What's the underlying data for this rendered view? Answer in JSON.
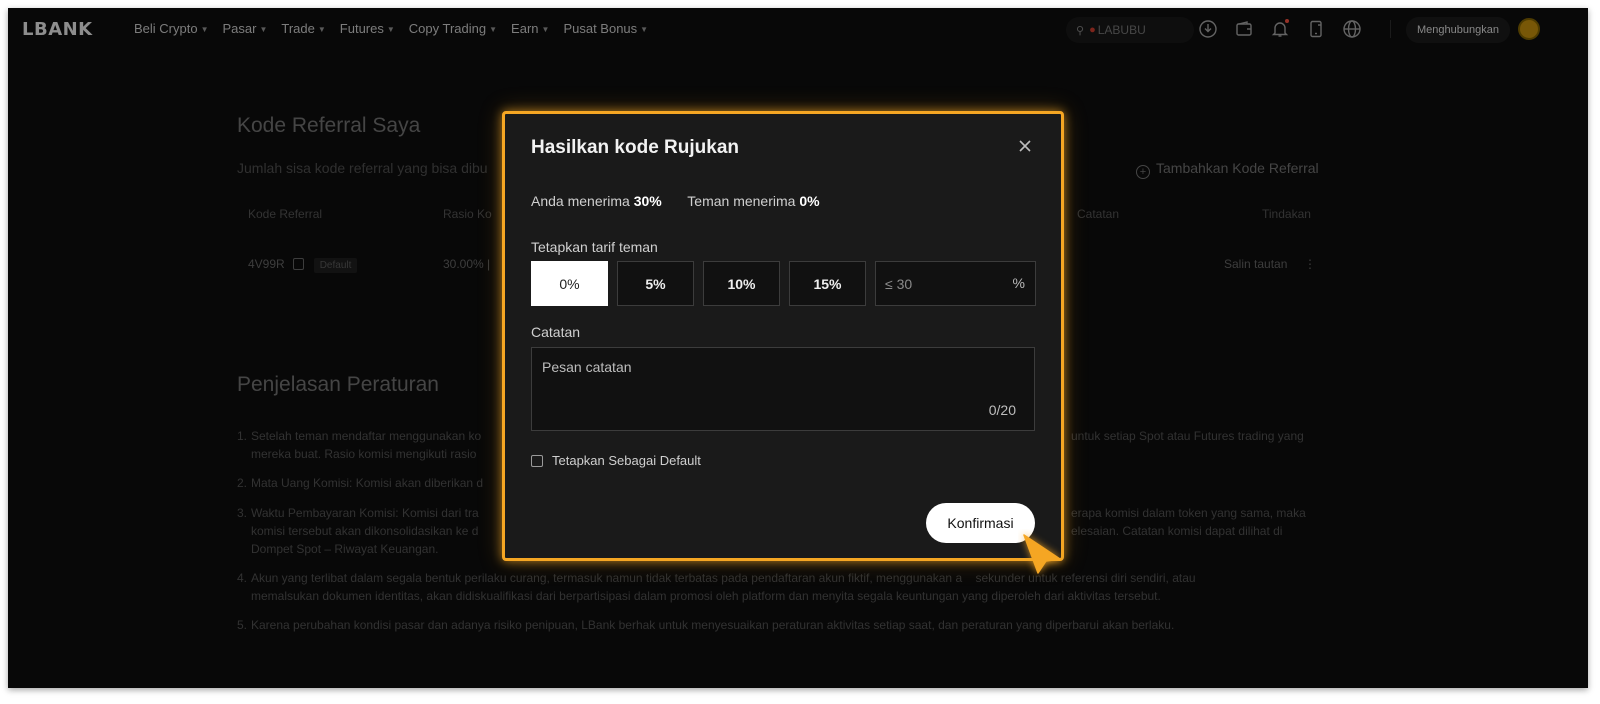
{
  "brand": {
    "logo": "LBANK",
    "accent_color": "#f5a623"
  },
  "nav": {
    "items": [
      "Beli Crypto",
      "Pasar",
      "Trade",
      "Futures",
      "Copy Trading",
      "Earn",
      "Pusat Bonus"
    ],
    "search_placeholder": "LABUBU",
    "connect_label": "Menghubungkan",
    "icons": [
      "download-icon",
      "wallet-icon",
      "bell-icon",
      "app-icon",
      "globe-icon"
    ]
  },
  "page": {
    "title": "Kode Referral Saya",
    "subtitle": "Jumlah sisa kode referral yang bisa dibu",
    "add_referral": "Tambahkan Kode Referral",
    "table": {
      "headers": [
        "Kode Referral",
        "Rasio Ko",
        "Catatan",
        "Tindakan"
      ],
      "row": {
        "code": "4V99R",
        "tag": "Default",
        "ratio": "30.00% |",
        "action": "Salin tautan"
      }
    },
    "rules_title": "Penjelasan Peraturan",
    "rules": [
      {
        "num": "1.",
        "text": "Setelah teman mendaftar menggunakan ko"
      },
      {
        "num": "",
        "text": "mereka buat. Rasio komisi mengikuti rasio"
      },
      {
        "num": "",
        "text": "untuk setiap Spot atau Futures trading yang"
      },
      {
        "num": "2.",
        "text": "Mata Uang Komisi: Komisi akan diberikan d"
      },
      {
        "num": "3.",
        "text": "Waktu Pembayaran Komisi: Komisi dari tra"
      },
      {
        "num": "",
        "text": "komisi tersebut akan dikonsolidasikan ke d"
      },
      {
        "num": "",
        "text": "Dompet Spot – Riwayat Keuangan."
      },
      {
        "num": "",
        "text": "erapa komisi dalam token yang sama, maka"
      },
      {
        "num": "",
        "text": "elesaian. Catatan komisi dapat dilihat di"
      },
      {
        "num": "4.",
        "text": "Akun yang terlibat dalam segala bentuk perilaku curang, termasuk namun tidak terbatas pada pendaftaran akun fiktif, menggunakan a    sekunder untuk referensi diri sendiri, atau"
      },
      {
        "num": "",
        "text": "memalsukan dokumen identitas, akan didiskualifikasi dari berpartisipasi dalam promosi oleh platform dan menyita segala keuntungan yang diperoleh dari aktivitas tersebut."
      },
      {
        "num": "5.",
        "text": "Karena perubahan kondisi pasar dan adanya risiko penipuan, LBank berhak untuk menyesuaikan peraturan aktivitas setiap saat, dan peraturan yang diperbarui akan berlaku."
      }
    ]
  },
  "modal": {
    "title": "Hasilkan kode Rujukan",
    "you_receive_label": "Anda menerima",
    "you_receive_value": "30%",
    "friend_receive_label": "Teman menerima",
    "friend_receive_value": "0%",
    "rate_label": "Tetapkan tarif teman",
    "rate_options": [
      "0%",
      "5%",
      "10%",
      "15%"
    ],
    "selected_rate": "0%",
    "custom_rate_placeholder": "≤ 30",
    "custom_rate_unit": "%",
    "note_label": "Catatan",
    "note_placeholder": "Pesan catatan",
    "note_counter": "0/20",
    "set_default_label": "Tetapkan Sebagai Default",
    "confirm_label": "Konfirmasi"
  }
}
